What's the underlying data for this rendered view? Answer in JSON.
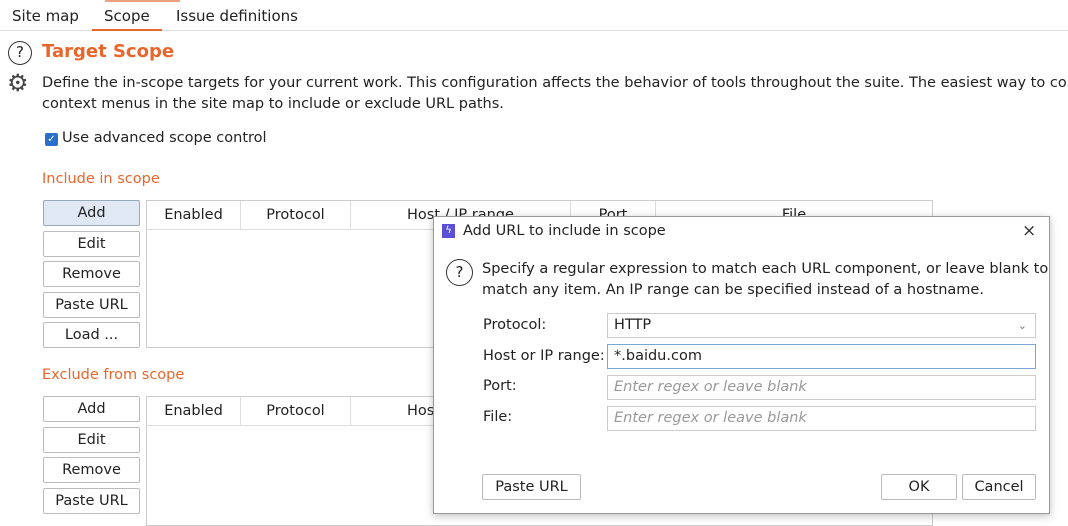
{
  "tabs": [
    {
      "label": "Site map"
    },
    {
      "label": "Scope"
    },
    {
      "label": "Issue definitions"
    }
  ],
  "active_tab": "Scope",
  "accent_color": "#e8662c",
  "page": {
    "title": "Target Scope",
    "description_line1": "Define the in-scope targets for your current work. This configuration affects the behavior of tools throughout the suite. The easiest way to configure",
    "description_line2": "context menus in the site map to include or exclude URL paths.",
    "advanced_label": "Use advanced scope control",
    "advanced_checked": true
  },
  "include": {
    "heading": "Include in scope",
    "buttons": [
      "Add",
      "Edit",
      "Remove",
      "Paste URL",
      "Load ..."
    ],
    "columns": [
      "Enabled",
      "Protocol",
      "Host / IP range",
      "Port",
      "File"
    ]
  },
  "exclude": {
    "heading": "Exclude from scope",
    "buttons": [
      "Add",
      "Edit",
      "Remove",
      "Paste URL"
    ],
    "columns": [
      "Enabled",
      "Protocol",
      "Host / IP range"
    ]
  },
  "dialog": {
    "title": "Add URL to include in scope",
    "close": "×",
    "info_line1": "Specify a regular expression to match each URL component, or leave blank to",
    "info_line2": "match any item. An IP range can be specified instead of a hostname.",
    "protocol_label": "Protocol:",
    "protocol_value": "HTTP",
    "host_label": "Host or IP range:",
    "host_value": "*.baidu.com",
    "port_label": "Port:",
    "port_placeholder": "Enter regex or leave blank",
    "file_label": "File:",
    "file_placeholder": "Enter regex or leave blank",
    "paste_url": "Paste URL",
    "ok": "OK",
    "cancel": "Cancel"
  }
}
